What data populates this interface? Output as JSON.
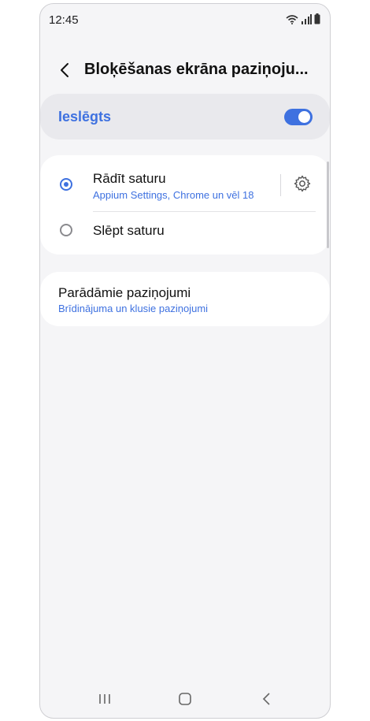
{
  "status_bar": {
    "time": "12:45"
  },
  "header": {
    "title": "Bloķēšanas ekrāna paziņoju..."
  },
  "master_switch": {
    "label": "Ieslēgts",
    "state": "on"
  },
  "options": {
    "show_content": {
      "title": "Rādīt saturu",
      "subtitle": "Appium Settings, Chrome un vēl 18",
      "selected": true
    },
    "hide_content": {
      "title": "Slēpt saturu",
      "selected": false
    }
  },
  "notifications_shown": {
    "title": "Parādāmie paziņojumi",
    "subtitle": "Brīdinājuma un klusie paziņojumi"
  },
  "colors": {
    "accent": "#3e71e0",
    "background": "#f5f5f7",
    "card": "#ffffff"
  },
  "icons": [
    "wifi-icon",
    "signal-icon",
    "battery-icon",
    "back-arrow-icon",
    "gear-icon",
    "recents-icon",
    "home-icon",
    "back-icon"
  ]
}
